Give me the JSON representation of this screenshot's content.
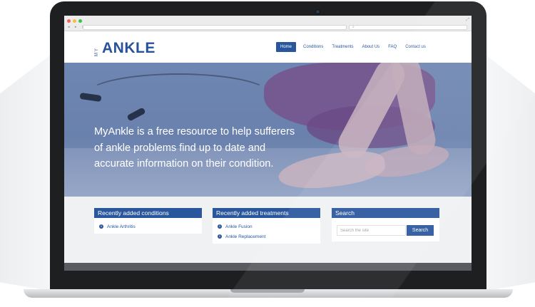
{
  "browser": {
    "nav_buttons": "◂ ▸ ▢",
    "search_icon": "search-icon",
    "expand_icon": "expand-icon"
  },
  "site": {
    "logo_prefix": "MY",
    "logo_main": "ANKLE"
  },
  "menu": {
    "items": [
      {
        "label": "Home",
        "active": true
      },
      {
        "label": "Conditions",
        "active": false
      },
      {
        "label": "Treatments",
        "active": false
      },
      {
        "label": "About Us",
        "active": false
      },
      {
        "label": "FAQ",
        "active": false
      },
      {
        "label": "Contact us",
        "active": false
      }
    ]
  },
  "hero": {
    "text": "MyAnkle is a free resource to help sufferers of ankle problems find up to date and accurate information on their condition."
  },
  "conditions": {
    "title": "Recently added conditions",
    "items": [
      {
        "label": "Ankle Arthritis"
      }
    ]
  },
  "treatments": {
    "title": "Recently added treatments",
    "items": [
      {
        "label": "Ankle Fusion"
      },
      {
        "label": "Ankle Replacement"
      }
    ]
  },
  "search": {
    "title": "Search",
    "placeholder": "Search the site",
    "button_label": "Search"
  },
  "colors": {
    "brand": "#2a569d",
    "hero_overlay": "#6e86b2",
    "laptop_bezel": "#1e1f21"
  }
}
